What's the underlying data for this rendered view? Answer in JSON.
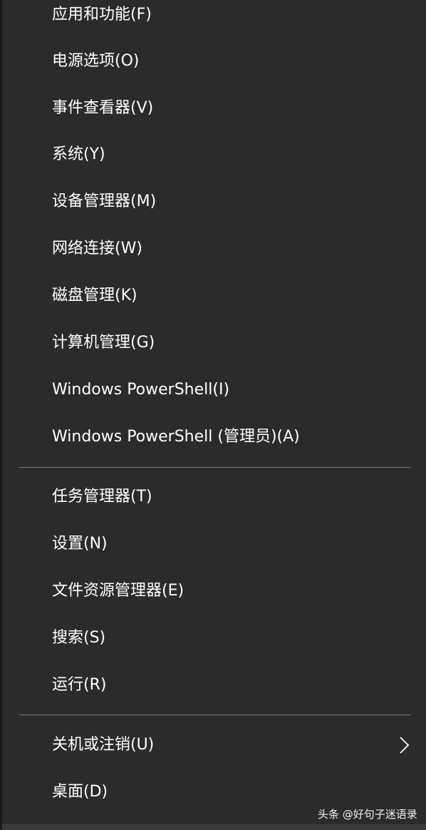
{
  "menu": {
    "items": [
      {
        "label": "应用和功能(F)"
      },
      {
        "label": "电源选项(O)"
      },
      {
        "label": "事件查看器(V)"
      },
      {
        "label": "系统(Y)"
      },
      {
        "label": "设备管理器(M)"
      },
      {
        "label": "网络连接(W)"
      },
      {
        "label": "磁盘管理(K)"
      },
      {
        "label": "计算机管理(G)"
      },
      {
        "label": "Windows PowerShell(I)"
      },
      {
        "label": "Windows PowerShell (管理员)(A)"
      },
      {
        "label": "任务管理器(T)"
      },
      {
        "label": "设置(N)"
      },
      {
        "label": "文件资源管理器(E)"
      },
      {
        "label": "搜索(S)"
      },
      {
        "label": "运行(R)"
      },
      {
        "label": "关机或注销(U)",
        "icon": "chevron-right-icon"
      },
      {
        "label": "桌面(D)"
      }
    ]
  },
  "watermark": {
    "text": "头条 @好句子迷语录"
  },
  "colors": {
    "background": "#2b2b2b",
    "text": "#ffffff",
    "separator": "#7a7a7a"
  }
}
